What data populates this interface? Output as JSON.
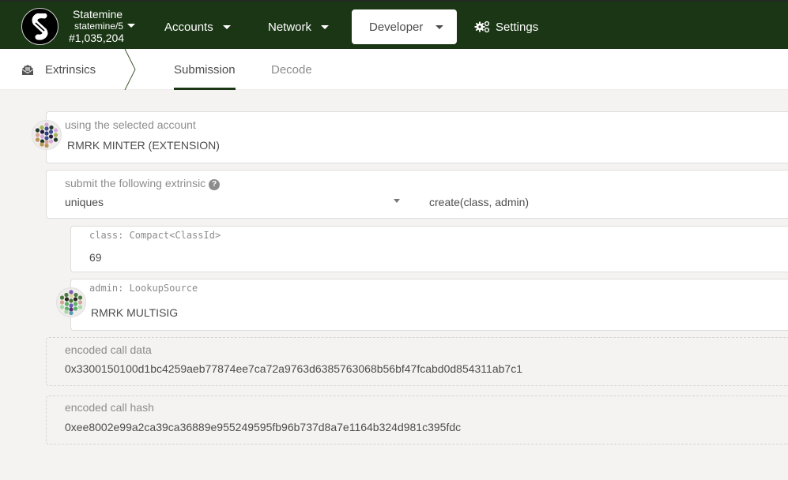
{
  "header": {
    "chain": {
      "name": "Statemine",
      "spec": "statemine/5",
      "block": "#1,035,204"
    },
    "nav": [
      {
        "label": "Accounts",
        "active": false
      },
      {
        "label": "Network",
        "active": false
      },
      {
        "label": "Developer",
        "active": true
      },
      {
        "label": "Settings",
        "active": false
      }
    ],
    "colors": {
      "bar": "#1a3614",
      "accent": "#1a3614"
    }
  },
  "subnav": {
    "section": "Extrinsics",
    "tabs": [
      {
        "label": "Submission",
        "active": true
      },
      {
        "label": "Decode",
        "active": false
      }
    ]
  },
  "form": {
    "account": {
      "label": "using the selected account",
      "value": "RMRK MINTER (EXTENSION)",
      "identicon": "account-identicon"
    },
    "extrinsic": {
      "label": "submit the following extrinsic",
      "help_icon": "question-circle-icon",
      "section": "uniques",
      "method": "create(class, admin)"
    },
    "params": [
      {
        "label": "class: Compact<ClassId>",
        "value": "69"
      },
      {
        "label": "admin: LookupSource",
        "value": "RMRK MULTISIG"
      }
    ],
    "encoded_call_data": {
      "label": "encoded call data",
      "value": "0x3300150100d1bc4259aeb77874ee7ca72a9763d6385763068b56bf47fcabd0d854311ab7c1"
    },
    "encoded_call_hash": {
      "label": "encoded call hash",
      "value": "0xee8002e99a2ca39ca36889e955249595fb96b737d8a7e1164b324d981c395fdc"
    }
  }
}
